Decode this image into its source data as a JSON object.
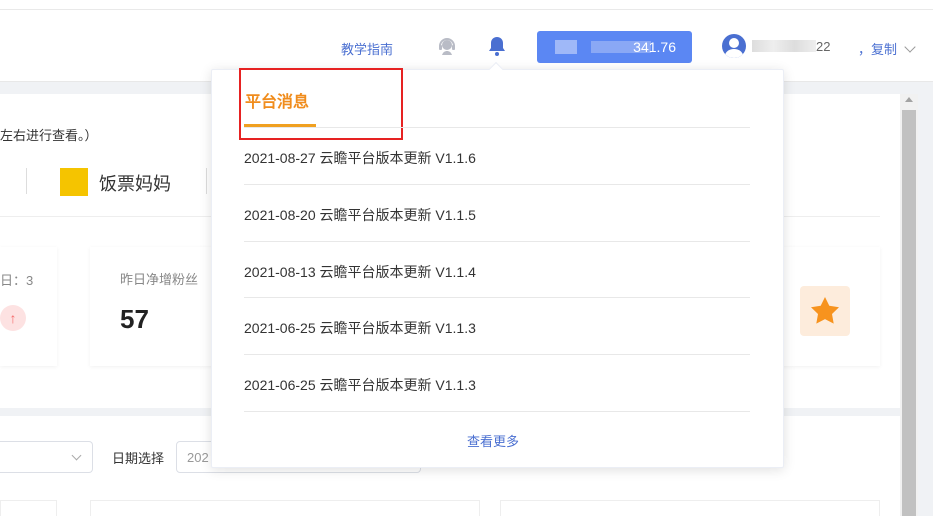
{
  "header": {
    "guide_label": "教学指南",
    "balance_value": "341.76",
    "user_suffix": "22",
    "copy_label": "，复制"
  },
  "main": {
    "hint_text": "左右进行查看。）",
    "brand_name": "饭票妈妈",
    "stat_left_label": "日：3",
    "stat_label": "昨日净增粉丝",
    "stat_value": "57",
    "date_label": "日期选择",
    "date_value": "202"
  },
  "notifications": {
    "title": "平台消息",
    "items": [
      {
        "text": "2021-08-27 云瞻平台版本更新 V1.1.6"
      },
      {
        "text": "2021-08-20 云瞻平台版本更新 V1.1.5"
      },
      {
        "text": "2021-08-13 云瞻平台版本更新 V1.1.4"
      },
      {
        "text": "2021-06-25 云瞻平台版本更新 V1.1.3"
      },
      {
        "text": "2021-06-25 云瞻平台版本更新 V1.1.3"
      }
    ],
    "more_label": "查看更多"
  },
  "colors": {
    "accent": "#f08c1c",
    "link": "#4a6fd1",
    "primary_button": "#5b87f3",
    "highlight_box": "#e62222"
  },
  "icons": [
    "support-icon",
    "bell-icon",
    "avatar-icon",
    "chevron-down-icon",
    "arrow-up-icon",
    "star-icon"
  ]
}
